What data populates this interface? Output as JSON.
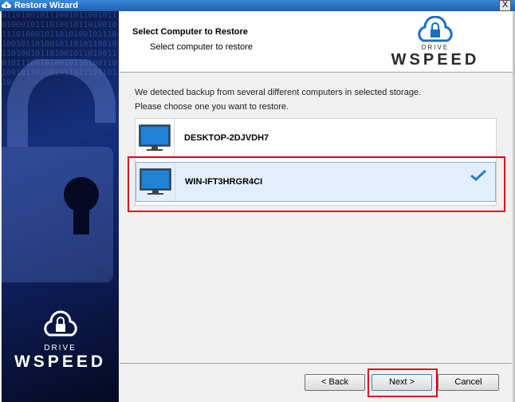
{
  "window": {
    "title": "Restore Wizard",
    "close_glyph": "X"
  },
  "header": {
    "title": "Select Computer to Restore",
    "subtitle": "Select computer to restore",
    "logo": {
      "small": "DRIVE",
      "brand": "WSPEED"
    }
  },
  "sidebar": {
    "logo": {
      "small": "DRIVE",
      "brand": "WSPEED"
    },
    "digits": "01101001011100101100101101000101110100101101001011101000101101010010111010010110100101101011001011010010110100101101001101011100101001011010011010010110100101101110010110"
  },
  "main": {
    "intro_line1": "We detected backup from several different computers in selected storage.",
    "intro_line2": "Please choose one you want to restore."
  },
  "computers": [
    {
      "name": "DESKTOP-2DJVDH7",
      "icon": "monitor-icon",
      "selected": false
    },
    {
      "name": "WIN-IFT3HRGR4CI",
      "icon": "monitor-icon",
      "selected": true
    }
  ],
  "buttons": {
    "back": "< Back",
    "next": "Next >",
    "cancel": "Cancel"
  },
  "colors": {
    "accent": "#1a7fd1",
    "highlight": "#e2001a",
    "selected_bg": "#e3eefc"
  }
}
